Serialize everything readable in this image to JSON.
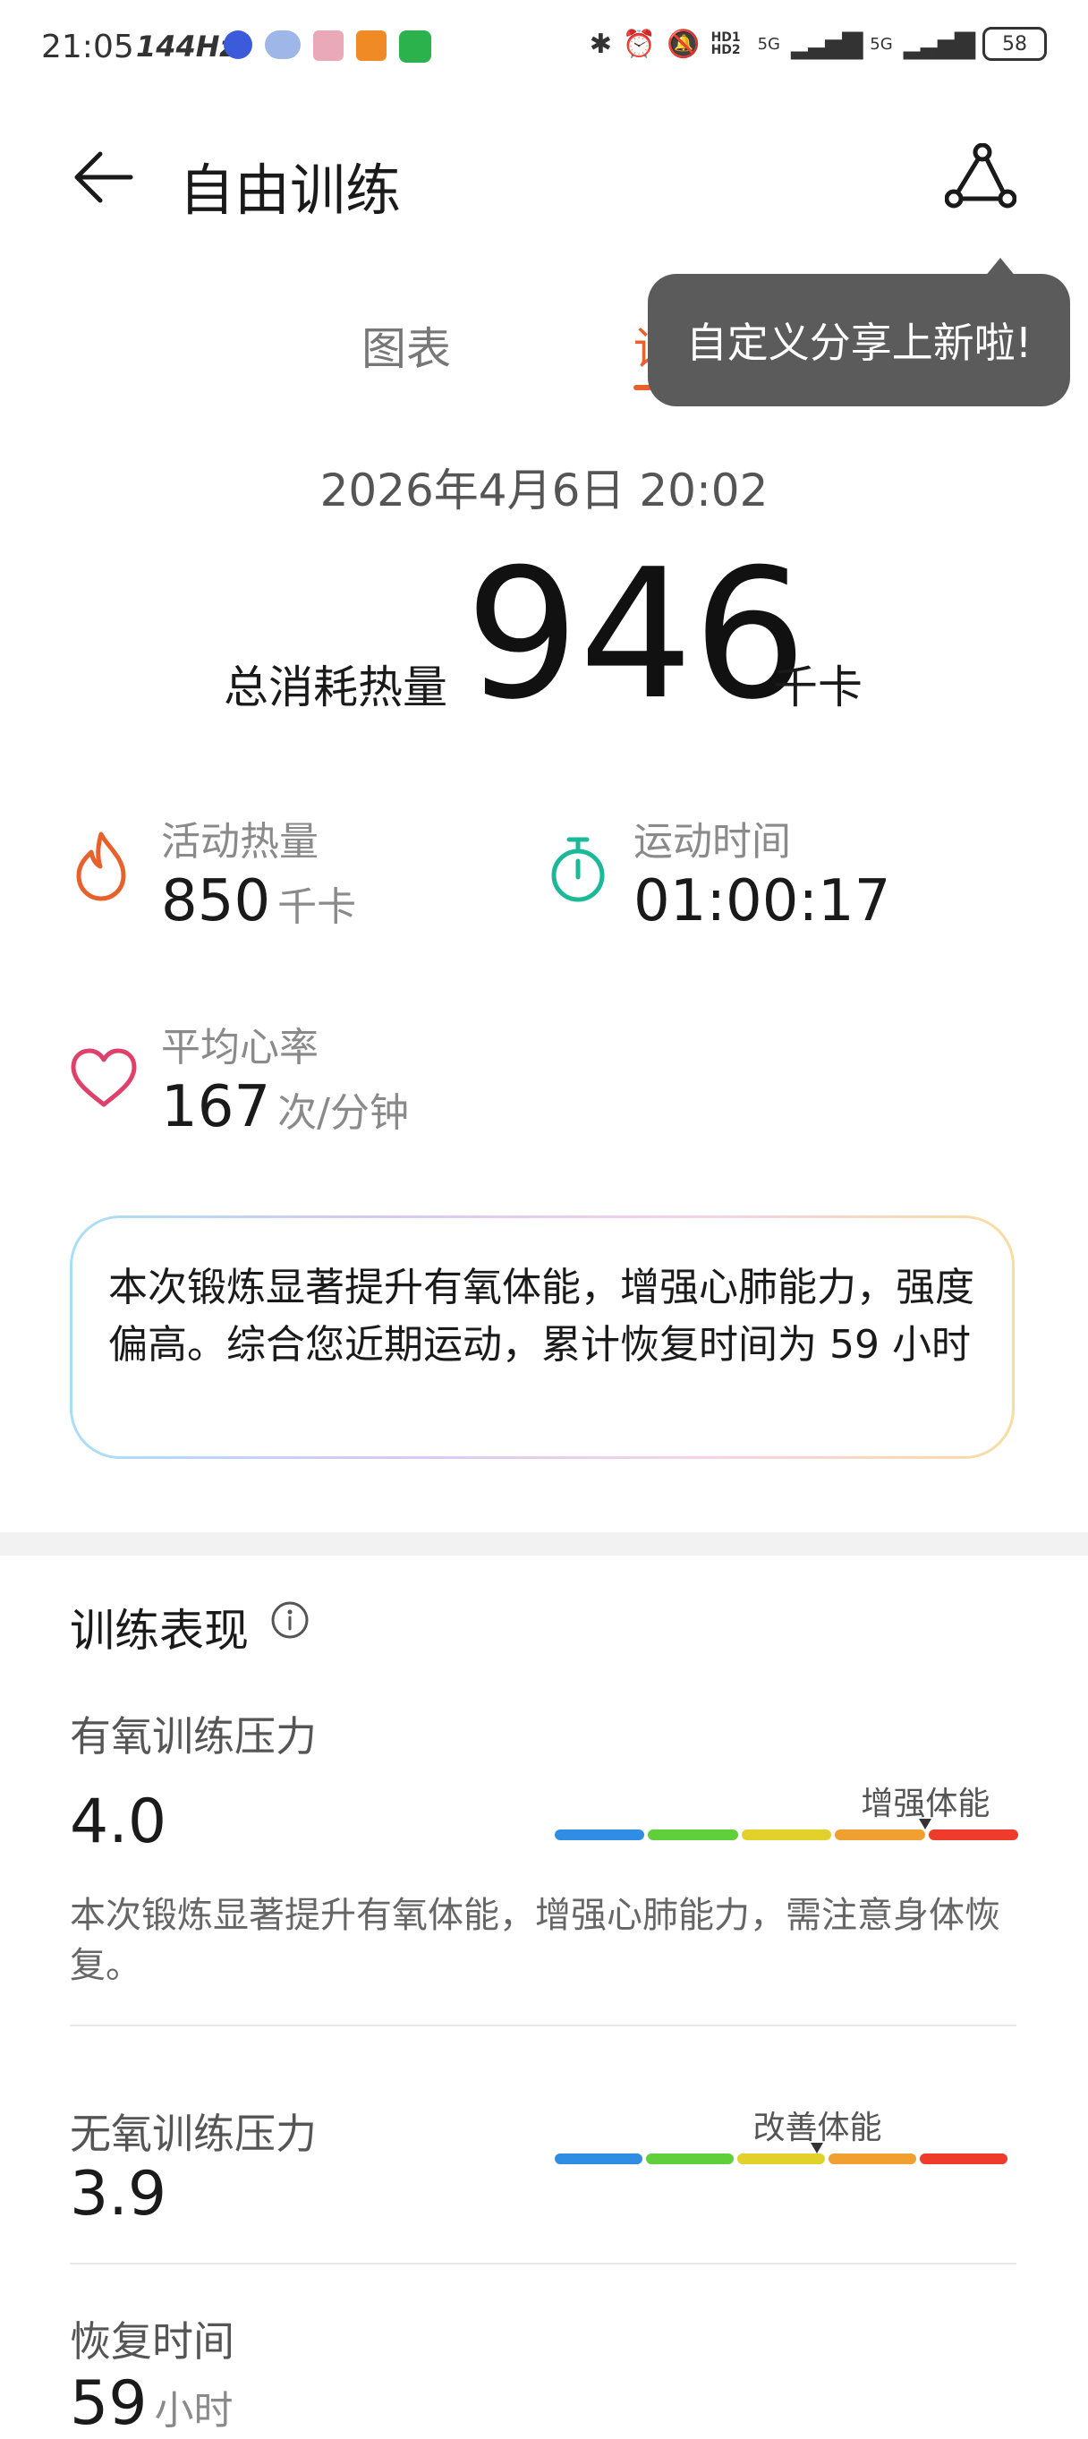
{
  "status_bar": {
    "time": "21:05",
    "refresh": "144Hz",
    "network1": "5G",
    "network2": "5G",
    "hd": "HD1 HD2",
    "battery": "58"
  },
  "header": {
    "title": "自由训练",
    "back_icon": "arrow-left-icon",
    "share_icon": "share-icon"
  },
  "tabs": [
    {
      "label": "图表"
    },
    {
      "label": "详"
    }
  ],
  "tooltip": {
    "text": "自定义分享上新啦!"
  },
  "summary": {
    "datetime": "2026年4月6日 20:02",
    "total_label": "总消耗热量",
    "total_value": "946",
    "total_unit": "千卡"
  },
  "stats": [
    {
      "label": "活动热量",
      "value": "850",
      "unit": "千卡",
      "icon": "flame-icon",
      "color": "#e8612c"
    },
    {
      "label": "运动时间",
      "value": "01:00:17",
      "unit": "",
      "icon": "stopwatch-icon",
      "color": "#1bb89a"
    },
    {
      "label": "平均心率",
      "value": "167",
      "unit": "次/分钟",
      "icon": "heart-icon",
      "color": "#e0416a"
    }
  ],
  "advice_card": {
    "text": "本次锻炼显著提升有氧体能，增强心肺能力，强度偏高。综合您近期运动，累计恢复时间为 59 小时"
  },
  "performance": {
    "title": "训练表现",
    "aerobic": {
      "label": "有氧训练压力",
      "value": "4.0",
      "level_label": "增强体能",
      "level_fraction": 0.8,
      "description": "本次锻炼显著提升有氧体能，增强心肺能力，需注意身体恢复。"
    },
    "anaerobic": {
      "label": "无氧训练压力",
      "value": "3.9",
      "level_label": "改善体能",
      "level_fraction": 0.58
    },
    "recovery": {
      "label": "恢复时间",
      "value": "59",
      "unit": "小时"
    }
  },
  "scale_colors": [
    "#2f8de4",
    "#5fcf3b",
    "#e2d12b",
    "#f0a030",
    "#ee3b2b"
  ]
}
